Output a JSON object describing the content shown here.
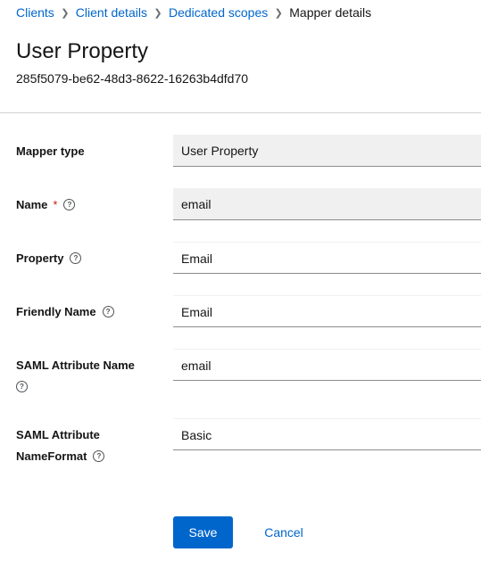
{
  "breadcrumb": {
    "items": [
      "Clients",
      "Client details",
      "Dedicated scopes"
    ],
    "current": "Mapper details"
  },
  "page": {
    "title": "User Property",
    "id": "285f5079-be62-48d3-8622-16263b4dfd70"
  },
  "form": {
    "mapper_type": {
      "label": "Mapper type",
      "value": "User Property"
    },
    "name": {
      "label": "Name",
      "required_mark": "*",
      "value": "email"
    },
    "property": {
      "label": "Property",
      "value": "Email"
    },
    "friendly_name": {
      "label": "Friendly Name",
      "value": "Email"
    },
    "saml_attribute_name": {
      "label": "SAML Attribute Name",
      "value": "email"
    },
    "saml_attribute_nameformat": {
      "label_line1": "SAML Attribute",
      "label_line2": "NameFormat",
      "value": "Basic"
    },
    "help_glyph": "?"
  },
  "actions": {
    "save": "Save",
    "cancel": "Cancel"
  },
  "icons": {
    "breadcrumb_separator": "chevron-right-icon",
    "help": "question-circle-icon"
  },
  "colors": {
    "link": "#0066cc",
    "primary": "#0066cc",
    "required": "#c9190b",
    "readonly_bg": "#f0f0f0"
  }
}
